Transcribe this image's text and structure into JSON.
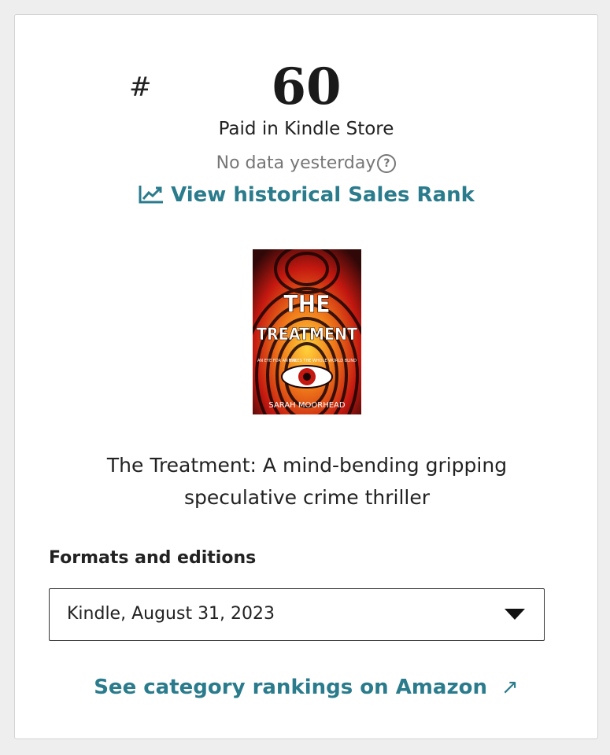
{
  "rank": {
    "hash": "#",
    "number": "60",
    "label": "Paid in Kindle Store",
    "no_data_text": "No data yesterday",
    "help_icon": "question-circle-icon"
  },
  "historical_link": {
    "icon": "trending-up-chart-icon",
    "label": "View historical Sales Rank"
  },
  "book": {
    "cover": {
      "title_line1": "THE",
      "title_line2": "TREATMENT",
      "author": "SARAH MOORHEAD",
      "tagline_left": "AN EYE FOR AN EYE",
      "tagline_right": "MAKES THE WHOLE WORLD BLIND"
    },
    "title_line1": "The Treatment: A mind-bending gripping",
    "title_line2": "speculative crime thriller"
  },
  "formats": {
    "heading": "Formats and editions",
    "selected": "Kindle, August 31, 2023"
  },
  "amazon_link": {
    "label": "See category rankings on Amazon",
    "icon": "external-arrow-icon",
    "glyph": "↗"
  },
  "colors": {
    "link": "#2a7b8c",
    "text": "#222222",
    "muted": "#767676"
  }
}
